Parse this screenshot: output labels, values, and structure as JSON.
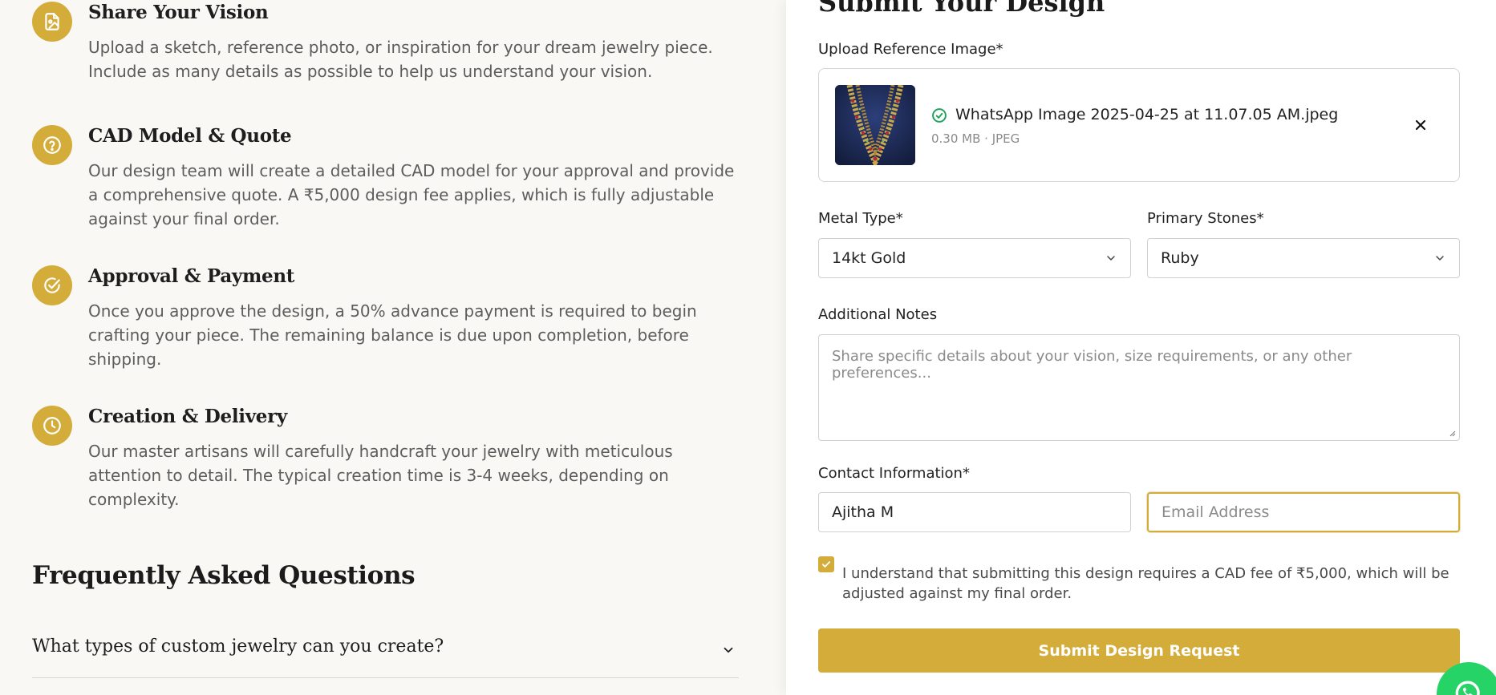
{
  "steps": [
    {
      "title": "Share Your Vision",
      "text": "Upload a sketch, reference photo, or inspiration for your dream jewelry piece. Include as many details as possible to help us understand your vision.",
      "icon": "image-upload-icon"
    },
    {
      "title": "CAD Model & Quote",
      "text": "Our design team will create a detailed CAD model for your approval and provide a comprehensive quote. A ₹5,000 design fee applies, which is fully adjustable against your final order.",
      "icon": "question-icon"
    },
    {
      "title": "Approval & Payment",
      "text": "Once you approve the design, a 50% advance payment is required to begin crafting your piece. The remaining balance is due upon completion, before shipping.",
      "icon": "check-circle-icon"
    },
    {
      "title": "Creation & Delivery",
      "text": "Our master artisans will carefully handcraft your jewelry with meticulous attention to detail. The typical creation time is 3-4 weeks, depending on complexity.",
      "icon": "clock-icon"
    }
  ],
  "faq": {
    "heading": "Frequently Asked Questions",
    "items": [
      {
        "question": "What types of custom jewelry can you create?"
      }
    ]
  },
  "form": {
    "title": "Submit Your Design",
    "upload_label": "Upload Reference Image*",
    "file": {
      "name": "WhatsApp Image 2025-04-25 at 11.07.05 AM.jpeg",
      "meta": "0.30 MB · JPEG"
    },
    "metal_label": "Metal Type*",
    "metal_value": "14kt Gold",
    "stones_label": "Primary Stones*",
    "stones_value": "Ruby",
    "notes_label": "Additional Notes",
    "notes_placeholder": "Share specific details about your vision, size requirements, or any other preferences...",
    "contact_label": "Contact Information*",
    "name_value": "Ajitha M",
    "email_placeholder": "Email Address",
    "consent_checked": true,
    "consent_text": "I understand that submitting this design requires a CAD fee of ₹5,000, which will be adjusted against my final order.",
    "submit_label": "Submit Design Request"
  },
  "colors": {
    "accent": "#d4ac3a",
    "whatsapp": "#25d366",
    "background": "#f9f8f5"
  }
}
